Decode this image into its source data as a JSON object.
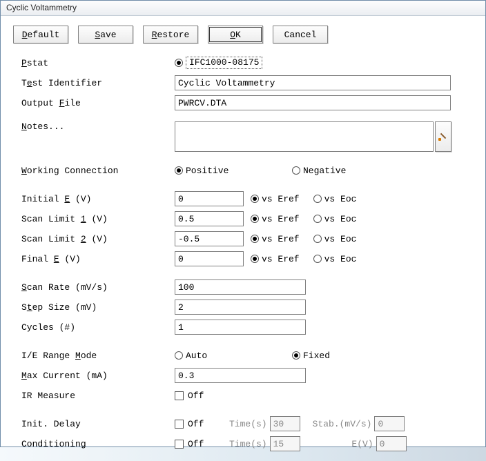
{
  "window": {
    "title": "Cyclic Voltammetry"
  },
  "buttons": {
    "default": "Default",
    "save": "Save",
    "restore": "Restore",
    "ok": "OK",
    "cancel": "Cancel"
  },
  "labels": {
    "pstat": "Pstat",
    "test_identifier": "Test Identifier",
    "output_file": "Output File",
    "notes": "Notes...",
    "working_connection": "Working Connection",
    "initial_e": "Initial E (V)",
    "scan_limit_1": "Scan Limit 1 (V)",
    "scan_limit_2": "Scan Limit 2 (V)",
    "final_e": "Final E (V)",
    "scan_rate": "Scan Rate (mV/s)",
    "step_size": "Step Size (mV)",
    "cycles": "Cycles (#)",
    "ie_range_mode": "I/E Range Mode",
    "max_current": "Max Current (mA)",
    "ir_measure": "IR Measure",
    "init_delay": "Init. Delay",
    "conditioning": "Conditioning"
  },
  "values": {
    "pstat_id": "IFC1000-08175",
    "test_identifier": "Cyclic Voltammetry",
    "output_file": "PWRCV.DTA",
    "notes": "",
    "initial_e": "0",
    "scan_limit_1": "0.5",
    "scan_limit_2": "-0.5",
    "final_e": "0",
    "scan_rate": "100",
    "step_size": "2",
    "cycles": "1",
    "max_current": "0.3",
    "init_delay_time": "30",
    "init_delay_stab": "0",
    "cond_time": "15",
    "cond_e": "0"
  },
  "options": {
    "positive": "Positive",
    "negative": "Negative",
    "vs_eref": "vs Eref",
    "vs_eoc": "vs Eoc",
    "auto": "Auto",
    "fixed": "Fixed",
    "off": "Off",
    "time_s": "Time(s)",
    "stab": "Stab.(mV/s)",
    "e_v": "E(V)"
  }
}
